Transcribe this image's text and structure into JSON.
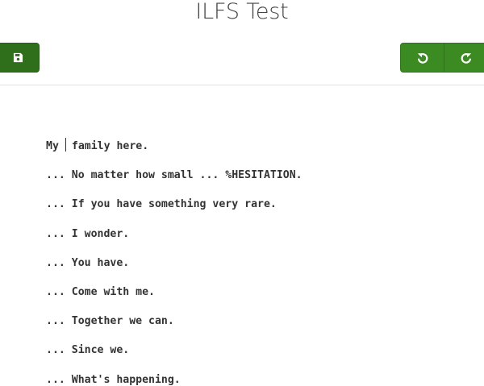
{
  "header": {
    "title": "ILFS Test"
  },
  "toolbar": {
    "save_icon": "floppy-disk-icon",
    "undo_icon": "undo-icon",
    "redo_icon": "redo-icon",
    "accent_color": "#3b8a22",
    "save_color": "#2f6f1b"
  },
  "transcript": {
    "first_line_before_cursor": "My",
    "first_line_after_cursor": "family here.",
    "lines": [
      "... No matter how small ... %HESITATION.",
      "... If you have something very rare.",
      "... I wonder.",
      "... You have.",
      "... Come with me.",
      "... Together we can.",
      "... Since we.",
      "... What's happening."
    ]
  }
}
